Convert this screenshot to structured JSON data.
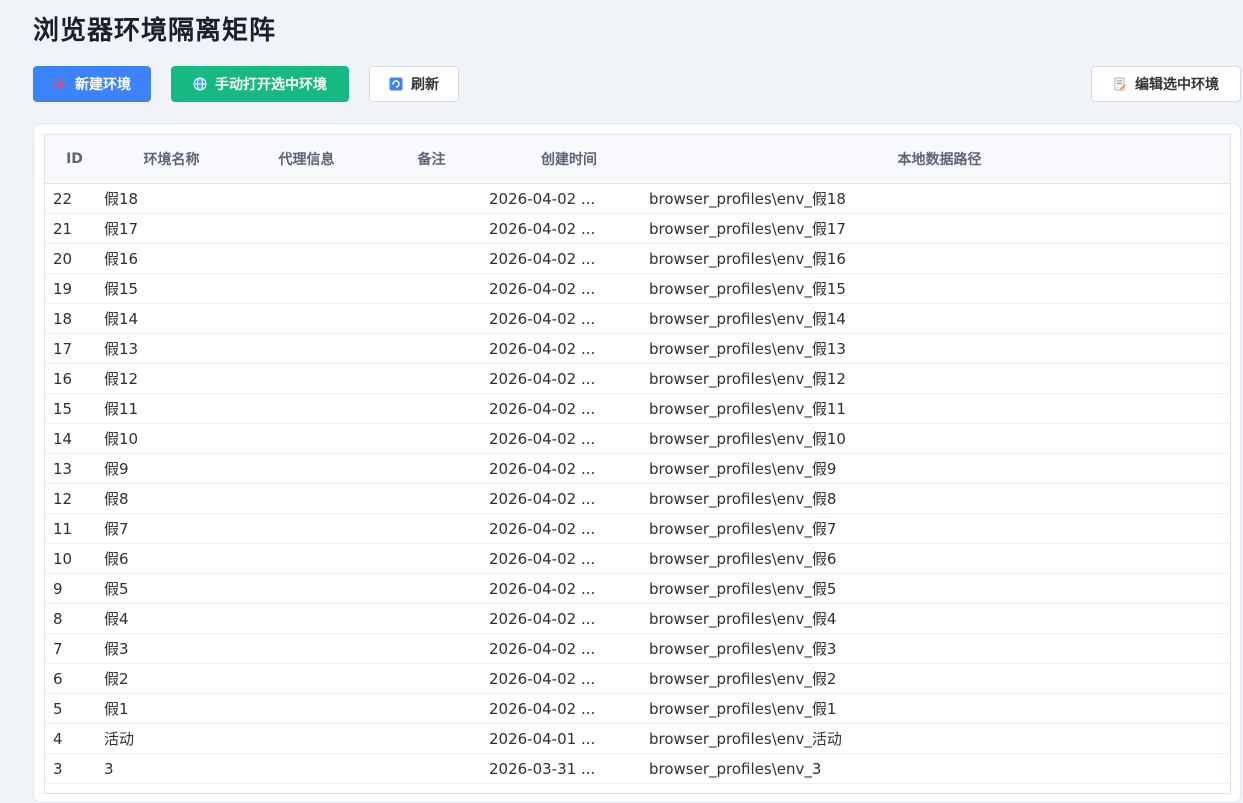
{
  "title": "浏览器环境隔离矩阵",
  "toolbar": {
    "new_label": "新建环境",
    "open_label": "手动打开选中环境",
    "refresh_label": "刷新",
    "edit_label": "编辑选中环境"
  },
  "table": {
    "headers": {
      "id": "ID",
      "name": "环境名称",
      "proxy": "代理信息",
      "note": "备注",
      "created": "创建时间",
      "path": "本地数据路径"
    },
    "rows": [
      {
        "id": "22",
        "name": "假18",
        "proxy": "",
        "note": "",
        "created": "2026-04-02 ...",
        "path": "browser_profiles\\env_假18"
      },
      {
        "id": "21",
        "name": "假17",
        "proxy": "",
        "note": "",
        "created": "2026-04-02 ...",
        "path": "browser_profiles\\env_假17"
      },
      {
        "id": "20",
        "name": "假16",
        "proxy": "",
        "note": "",
        "created": "2026-04-02 ...",
        "path": "browser_profiles\\env_假16"
      },
      {
        "id": "19",
        "name": "假15",
        "proxy": "",
        "note": "",
        "created": "2026-04-02 ...",
        "path": "browser_profiles\\env_假15"
      },
      {
        "id": "18",
        "name": "假14",
        "proxy": "",
        "note": "",
        "created": "2026-04-02 ...",
        "path": "browser_profiles\\env_假14"
      },
      {
        "id": "17",
        "name": "假13",
        "proxy": "",
        "note": "",
        "created": "2026-04-02 ...",
        "path": "browser_profiles\\env_假13"
      },
      {
        "id": "16",
        "name": "假12",
        "proxy": "",
        "note": "",
        "created": "2026-04-02 ...",
        "path": "browser_profiles\\env_假12"
      },
      {
        "id": "15",
        "name": "假11",
        "proxy": "",
        "note": "",
        "created": "2026-04-02 ...",
        "path": "browser_profiles\\env_假11"
      },
      {
        "id": "14",
        "name": "假10",
        "proxy": "",
        "note": "",
        "created": "2026-04-02 ...",
        "path": "browser_profiles\\env_假10"
      },
      {
        "id": "13",
        "name": "假9",
        "proxy": "",
        "note": "",
        "created": "2026-04-02 ...",
        "path": "browser_profiles\\env_假9"
      },
      {
        "id": "12",
        "name": "假8",
        "proxy": "",
        "note": "",
        "created": "2026-04-02 ...",
        "path": "browser_profiles\\env_假8"
      },
      {
        "id": "11",
        "name": "假7",
        "proxy": "",
        "note": "",
        "created": "2026-04-02 ...",
        "path": "browser_profiles\\env_假7"
      },
      {
        "id": "10",
        "name": "假6",
        "proxy": "",
        "note": "",
        "created": "2026-04-02 ...",
        "path": "browser_profiles\\env_假6"
      },
      {
        "id": "9",
        "name": "假5",
        "proxy": "",
        "note": "",
        "created": "2026-04-02 ...",
        "path": "browser_profiles\\env_假5"
      },
      {
        "id": "8",
        "name": "假4",
        "proxy": "",
        "note": "",
        "created": "2026-04-02 ...",
        "path": "browser_profiles\\env_假4"
      },
      {
        "id": "7",
        "name": "假3",
        "proxy": "",
        "note": "",
        "created": "2026-04-02 ...",
        "path": "browser_profiles\\env_假3"
      },
      {
        "id": "6",
        "name": "假2",
        "proxy": "",
        "note": "",
        "created": "2026-04-02 ...",
        "path": "browser_profiles\\env_假2"
      },
      {
        "id": "5",
        "name": "假1",
        "proxy": "",
        "note": "",
        "created": "2026-04-02 ...",
        "path": "browser_profiles\\env_假1"
      },
      {
        "id": "4",
        "name": "活动",
        "proxy": "",
        "note": "",
        "created": "2026-04-01 ...",
        "path": "browser_profiles\\env_活动"
      },
      {
        "id": "3",
        "name": "3",
        "proxy": "",
        "note": "",
        "created": "2026-03-31 ...",
        "path": "browser_profiles\\env_3"
      }
    ]
  },
  "icons": {
    "new": "plus-icon",
    "open": "globe-icon",
    "refresh": "refresh-icon",
    "edit": "edit-icon"
  },
  "colors": {
    "primary": "#3d82f6",
    "success": "#16b981",
    "background": "#f0f3f8"
  }
}
